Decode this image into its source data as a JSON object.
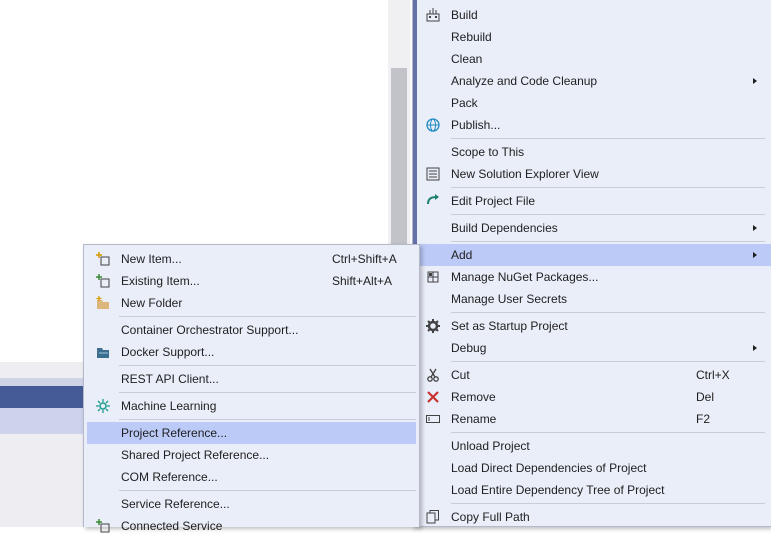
{
  "main_menu": {
    "items": [
      {
        "label": "Build",
        "icon": "build-icon"
      },
      {
        "label": "Rebuild"
      },
      {
        "label": "Clean"
      },
      {
        "label": "Analyze and Code Cleanup",
        "submenu": true
      },
      {
        "label": "Pack"
      },
      {
        "label": "Publish...",
        "icon": "globe-icon"
      },
      {
        "label": "Scope to This"
      },
      {
        "label": "New Solution Explorer View",
        "icon": "solution-explorer-icon"
      },
      {
        "label": "Edit Project File",
        "icon": "edit-project-icon"
      },
      {
        "label": "Build Dependencies",
        "submenu": true
      },
      {
        "label": "Add",
        "submenu": true
      },
      {
        "label": "Manage NuGet Packages...",
        "icon": "nuget-icon"
      },
      {
        "label": "Manage User Secrets"
      },
      {
        "label": "Set as Startup Project",
        "icon": "gear-icon"
      },
      {
        "label": "Debug",
        "submenu": true
      },
      {
        "label": "Cut",
        "shortcut": "Ctrl+X",
        "icon": "scissors-icon"
      },
      {
        "label": "Remove",
        "shortcut": "Del",
        "icon": "close-icon"
      },
      {
        "label": "Rename",
        "shortcut": "F2",
        "icon": "rename-icon"
      },
      {
        "label": "Unload Project"
      },
      {
        "label": "Load Direct Dependencies of Project"
      },
      {
        "label": "Load Entire Dependency Tree of Project"
      },
      {
        "label": "Copy Full Path",
        "icon": "copy-icon"
      }
    ]
  },
  "add_submenu": {
    "items": [
      {
        "label": "New Item...",
        "shortcut": "Ctrl+Shift+A",
        "icon": "new-item-icon"
      },
      {
        "label": "Existing Item...",
        "shortcut": "Shift+Alt+A",
        "icon": "existing-item-icon"
      },
      {
        "label": "New Folder",
        "icon": "new-folder-icon"
      },
      {
        "label": "Container Orchestrator Support..."
      },
      {
        "label": "Docker Support...",
        "icon": "docker-icon"
      },
      {
        "label": "REST API Client..."
      },
      {
        "label": "Machine Learning",
        "icon": "machine-learning-icon"
      },
      {
        "label": "Project Reference..."
      },
      {
        "label": "Shared Project Reference..."
      },
      {
        "label": "COM Reference..."
      },
      {
        "label": "Service Reference..."
      },
      {
        "label": "Connected Service",
        "icon": "connected-service-icon"
      }
    ]
  },
  "colors": {
    "highlight": "#bccaf7",
    "menu_bg": "#eaeef9",
    "accent": "#6470a8"
  }
}
